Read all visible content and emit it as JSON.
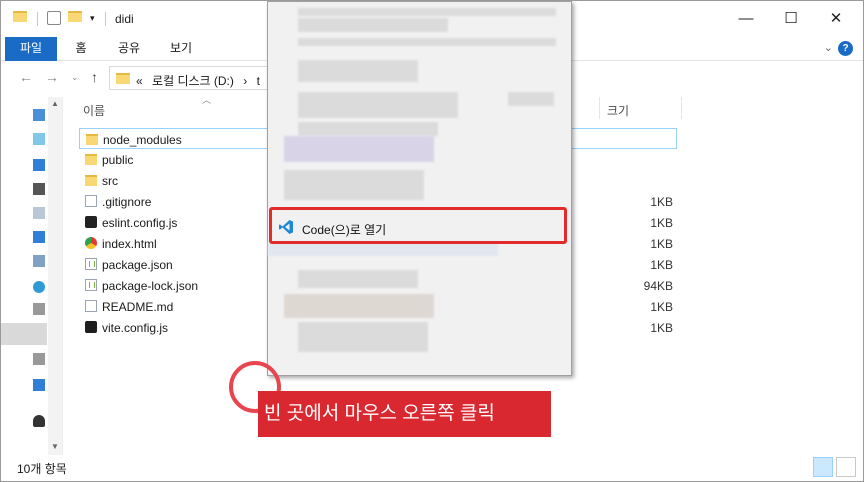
{
  "window": {
    "title": "didi"
  },
  "title_buttons": {
    "minimize": "—",
    "maximize": "☐",
    "close": "✕"
  },
  "ribbon": {
    "tabs": [
      "파일",
      "홈",
      "공유",
      "보기"
    ]
  },
  "address": {
    "prefix": "«",
    "path": "로컬 디스크 (D:)",
    "sep": "›",
    "next": "t"
  },
  "columns": {
    "name": "이름",
    "size": "크기"
  },
  "files": [
    {
      "name": "node_modules",
      "icon": "folder-icon",
      "size": ""
    },
    {
      "name": "public",
      "icon": "folder-icon",
      "size": ""
    },
    {
      "name": "src",
      "icon": "folder-icon",
      "size": ""
    },
    {
      "name": ".gitignore",
      "icon": "file-icon",
      "size": "1KB"
    },
    {
      "name": "eslint.config.js",
      "icon": "eslint-icon",
      "size": "1KB"
    },
    {
      "name": "index.html",
      "icon": "chrome-icon",
      "size": "1KB"
    },
    {
      "name": "package.json",
      "icon": "json-icon",
      "size": "1KB"
    },
    {
      "name": "package-lock.json",
      "icon": "json-icon",
      "size": "94KB"
    },
    {
      "name": "README.md",
      "icon": "file-icon",
      "size": "1KB"
    },
    {
      "name": "vite.config.js",
      "icon": "vite-icon",
      "size": "1KB"
    }
  ],
  "status": {
    "count": "10개 항목"
  },
  "context_menu": {
    "highlighted_item": "Code(으)로 열기"
  },
  "annotation": {
    "callout": "빈 곳에서 마우스 오른쪽 클릭",
    "color": "#d9282f"
  }
}
